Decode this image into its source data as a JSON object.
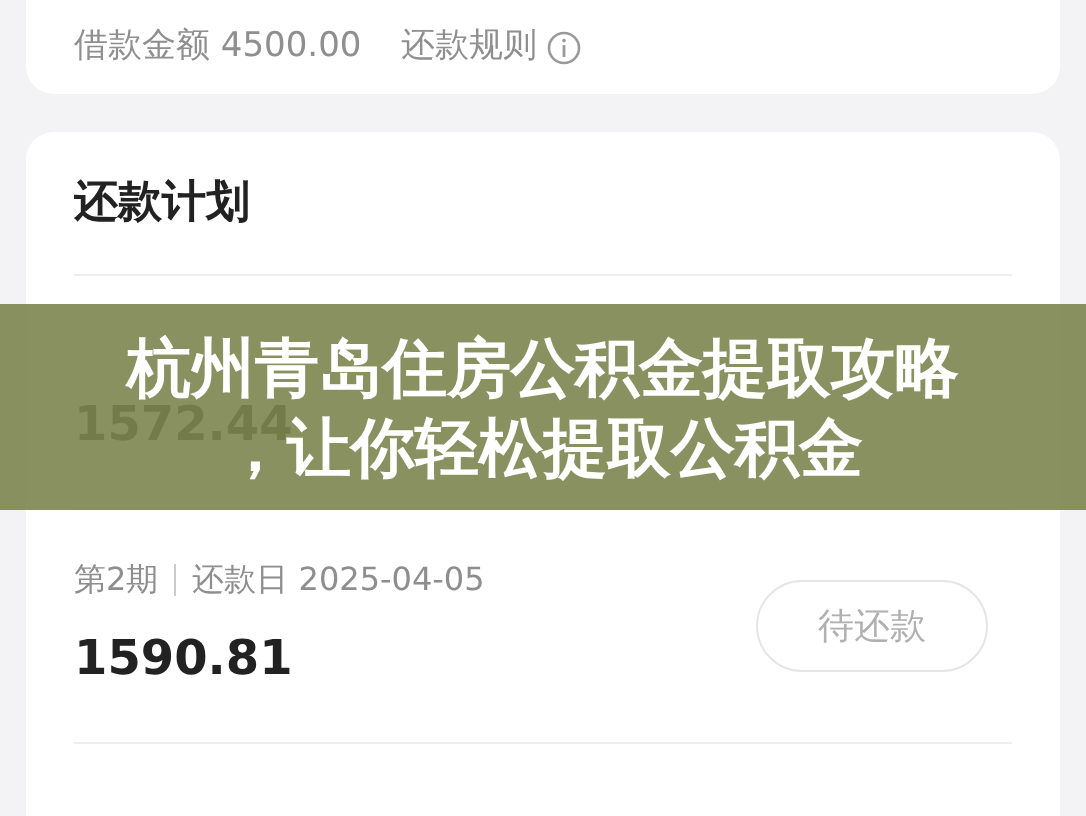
{
  "loan_summary": {
    "amount_label": "借款金额 4500.00",
    "rules_link": "还款规则"
  },
  "plan": {
    "title": "还款计划",
    "installments": [
      {
        "amount": "1572.44"
      },
      {
        "period": "第2期",
        "date": "还款日 2025-04-05",
        "amount": "1590.81",
        "status": "待还款"
      }
    ]
  },
  "banner": {
    "lines": [
      "杭州青岛住房公积金提取攻略",
      "，让你轻松提取公积金"
    ]
  }
}
